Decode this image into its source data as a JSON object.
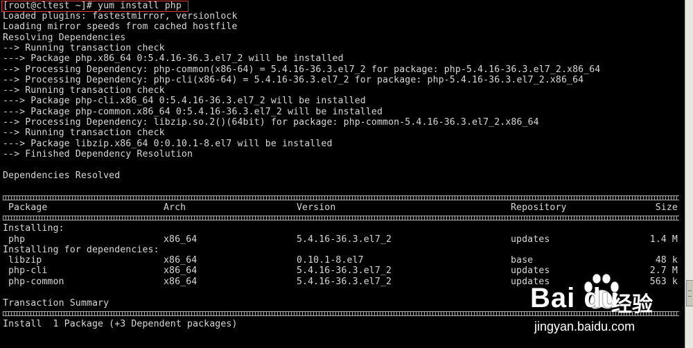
{
  "terminal": {
    "prompt": "[root@cltest ~]# ",
    "command": "yum install php",
    "log": [
      "Loaded plugins: fastestmirror, versionlock",
      "Loading mirror speeds from cached hostfile",
      "Resolving Dependencies",
      "--> Running transaction check",
      "---> Package php.x86_64 0:5.4.16-36.3.el7_2 will be installed",
      "--> Processing Dependency: php-common(x86-64) = 5.4.16-36.3.el7_2 for package: php-5.4.16-36.3.el7_2.x86_64",
      "--> Processing Dependency: php-cli(x86-64) = 5.4.16-36.3.el7_2 for package: php-5.4.16-36.3.el7_2.x86_64",
      "--> Running transaction check",
      "---> Package php-cli.x86_64 0:5.4.16-36.3.el7_2 will be installed",
      "---> Package php-common.x86_64 0:5.4.16-36.3.el7_2 will be installed",
      "--> Processing Dependency: libzip.so.2()(64bit) for package: php-common-5.4.16-36.3.el7_2.x86_64",
      "--> Running transaction check",
      "---> Package libzip.x86_64 0:0.10.1-8.el7 will be installed",
      "--> Finished Dependency Resolution"
    ],
    "resolved": "Dependencies Resolved",
    "table": {
      "headers": {
        "package": "Package",
        "arch": "Arch",
        "version": "Version",
        "repository": "Repository",
        "size": "Size"
      },
      "installing_label": "Installing:",
      "installing": [
        {
          "package": "php",
          "arch": "x86_64",
          "version": "5.4.16-36.3.el7_2",
          "repository": "updates",
          "size": "1.4 M"
        }
      ],
      "deps_label": "Installing for dependencies:",
      "deps": [
        {
          "package": "libzip",
          "arch": "x86_64",
          "version": "0.10.1-8.el7",
          "repository": "base",
          "size": "48 k"
        },
        {
          "package": "php-cli",
          "arch": "x86_64",
          "version": "5.4.16-36.3.el7_2",
          "repository": "updates",
          "size": "2.7 M"
        },
        {
          "package": "php-common",
          "arch": "x86_64",
          "version": "5.4.16-36.3.el7_2",
          "repository": "updates",
          "size": "563 k"
        }
      ]
    },
    "summary_title": "Transaction Summary",
    "summary_line": "Install  1 Package (+3 Dependent packages)"
  },
  "watermark": {
    "brand": "Bai du",
    "cn": "经验",
    "url": "jingyan.baidu.com"
  },
  "colors": {
    "background": "#000000",
    "text": "#d8d8d8",
    "highlight": "#e0383e"
  }
}
